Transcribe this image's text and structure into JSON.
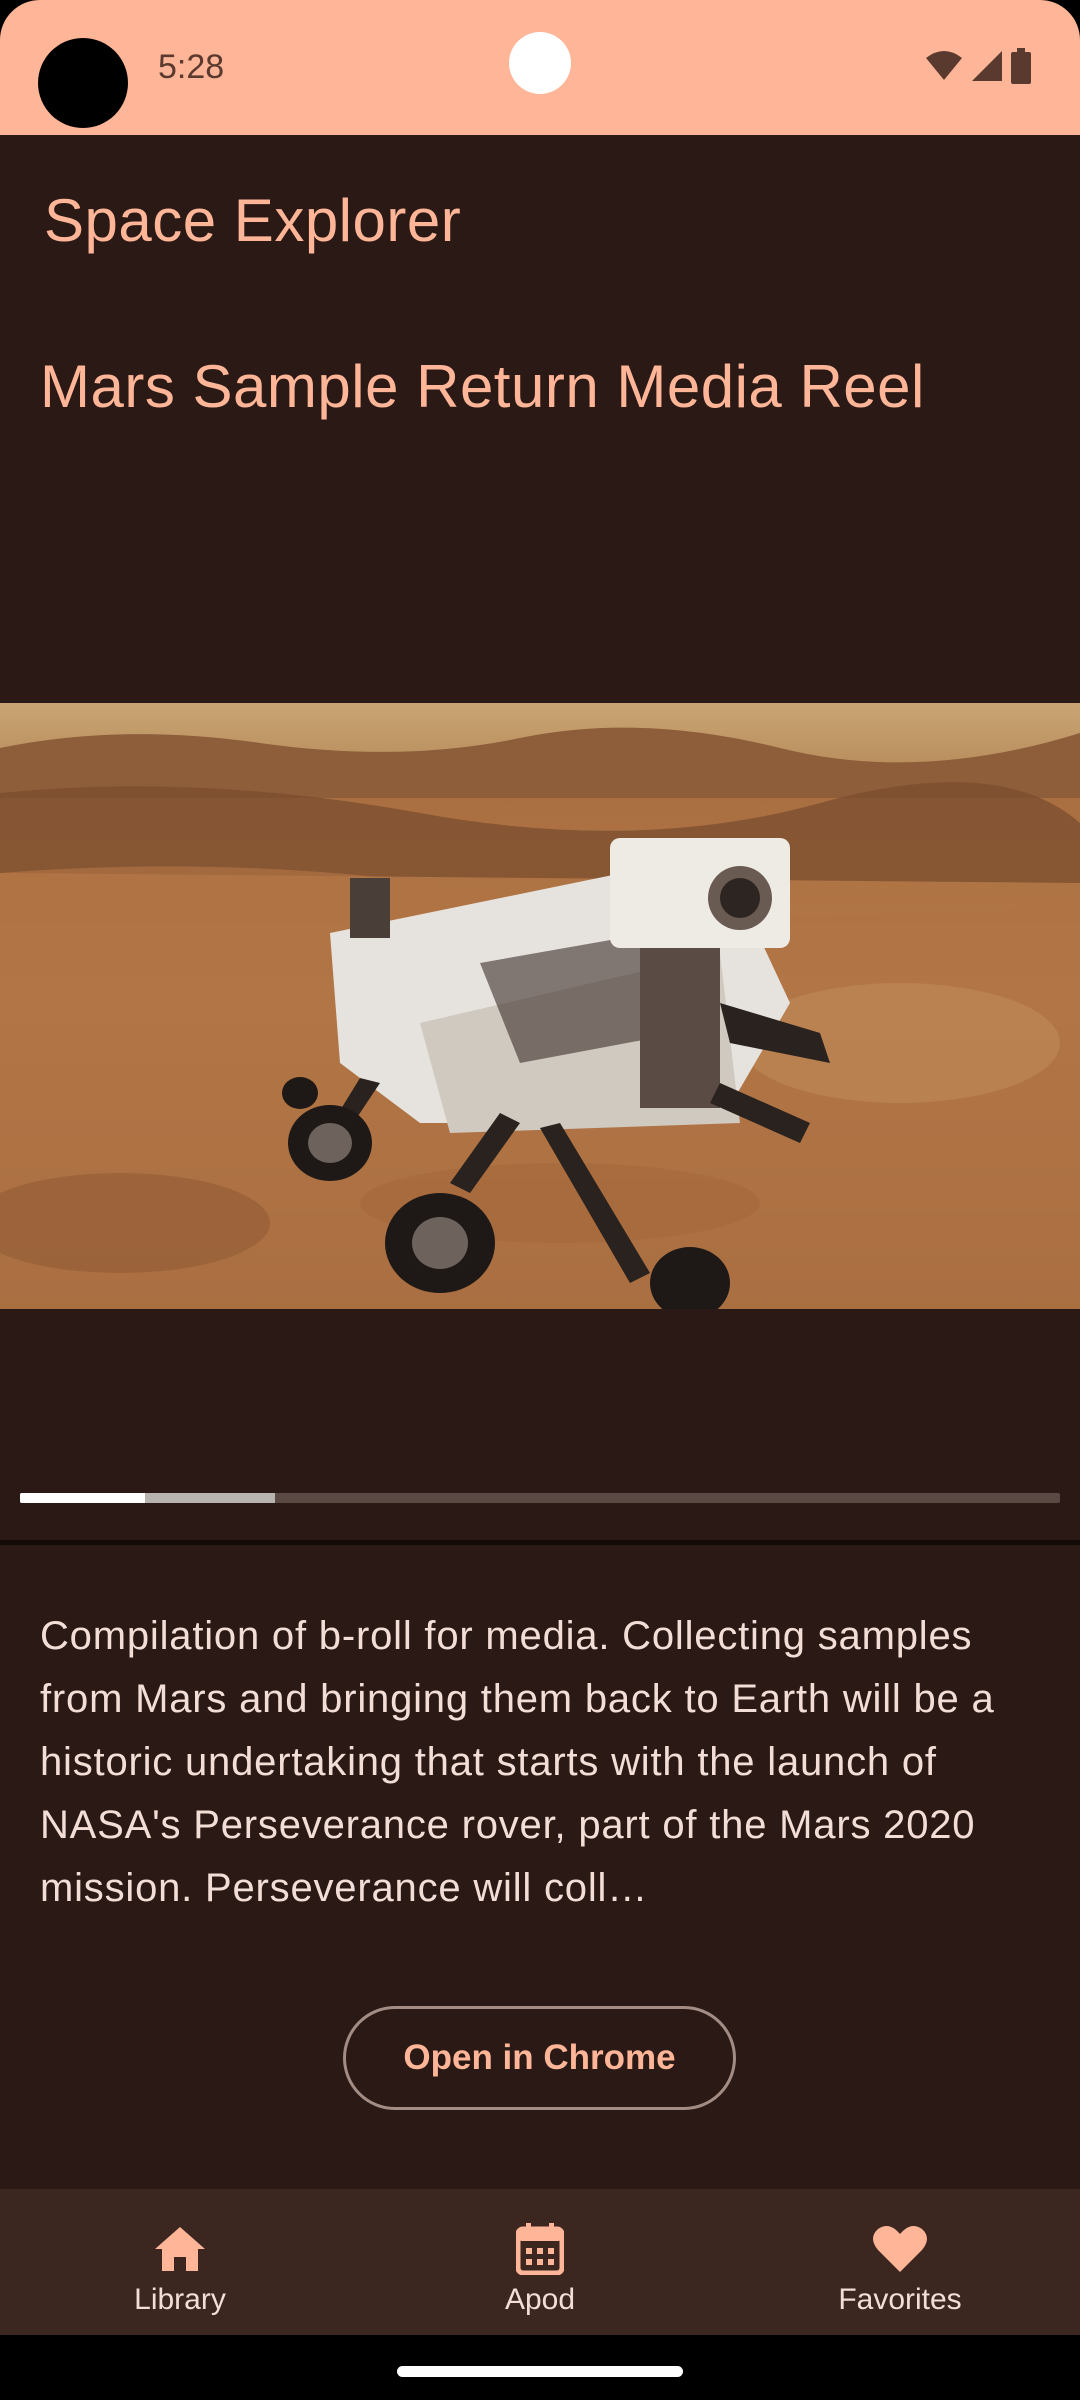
{
  "status_bar": {
    "time": "5:28",
    "icons": [
      "wifi-icon",
      "signal-icon",
      "battery-icon"
    ]
  },
  "app_bar": {
    "title": "Space Explorer"
  },
  "media": {
    "title": "Mars Sample Return Media Reel",
    "thumbnail": "mars-rover-perseverance",
    "progress_played": 0.12,
    "progress_buffered": 0.245
  },
  "description": "Compilation of b-roll for media. Collecting samples from Mars and bringing them back to Earth will be a historic undertaking that starts with the launch of NASA's Perseverance rover, part of the Mars 2020 mission. Perseverance will coll…",
  "actions": {
    "open_label": "Open in Chrome"
  },
  "bottom_nav": {
    "items": [
      {
        "label": "Library",
        "icon": "home-icon"
      },
      {
        "label": "Apod",
        "icon": "calendar-icon"
      },
      {
        "label": "Favorites",
        "icon": "heart-icon"
      }
    ]
  },
  "colors": {
    "accent": "#ffb598",
    "background": "#2a1914",
    "nav_background": "#3b2620",
    "text": "#f3ded7"
  }
}
